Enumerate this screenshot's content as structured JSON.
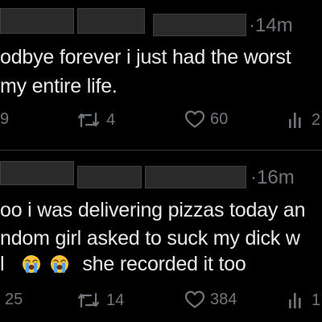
{
  "colors": {
    "background": "#000000",
    "text": "#e7e9ea",
    "muted": "#71767b",
    "divider": "#2f3336",
    "redaction": "#2a2a2b"
  },
  "tweets": [
    {
      "time": "·14m",
      "lines": [
        "odbye forever i just had the worst",
        "my entire life."
      ],
      "replies": "9",
      "retweets": "4",
      "likes": "60",
      "views": "2"
    },
    {
      "time": "·16m",
      "lines": [
        "oo i was delivering pizzas today an",
        "ndom girl asked to suck my dick w",
        "she recorded it too"
      ],
      "line3_prefix": "l",
      "emoji": "loudly-crying-face",
      "replies": "25",
      "retweets": "14",
      "likes": "384",
      "views": "1"
    }
  ],
  "icons": {
    "reply": "reply-bubble-icon",
    "retweet": "retweet-icon",
    "like": "heart-icon",
    "views": "views-bar-chart-icon"
  }
}
